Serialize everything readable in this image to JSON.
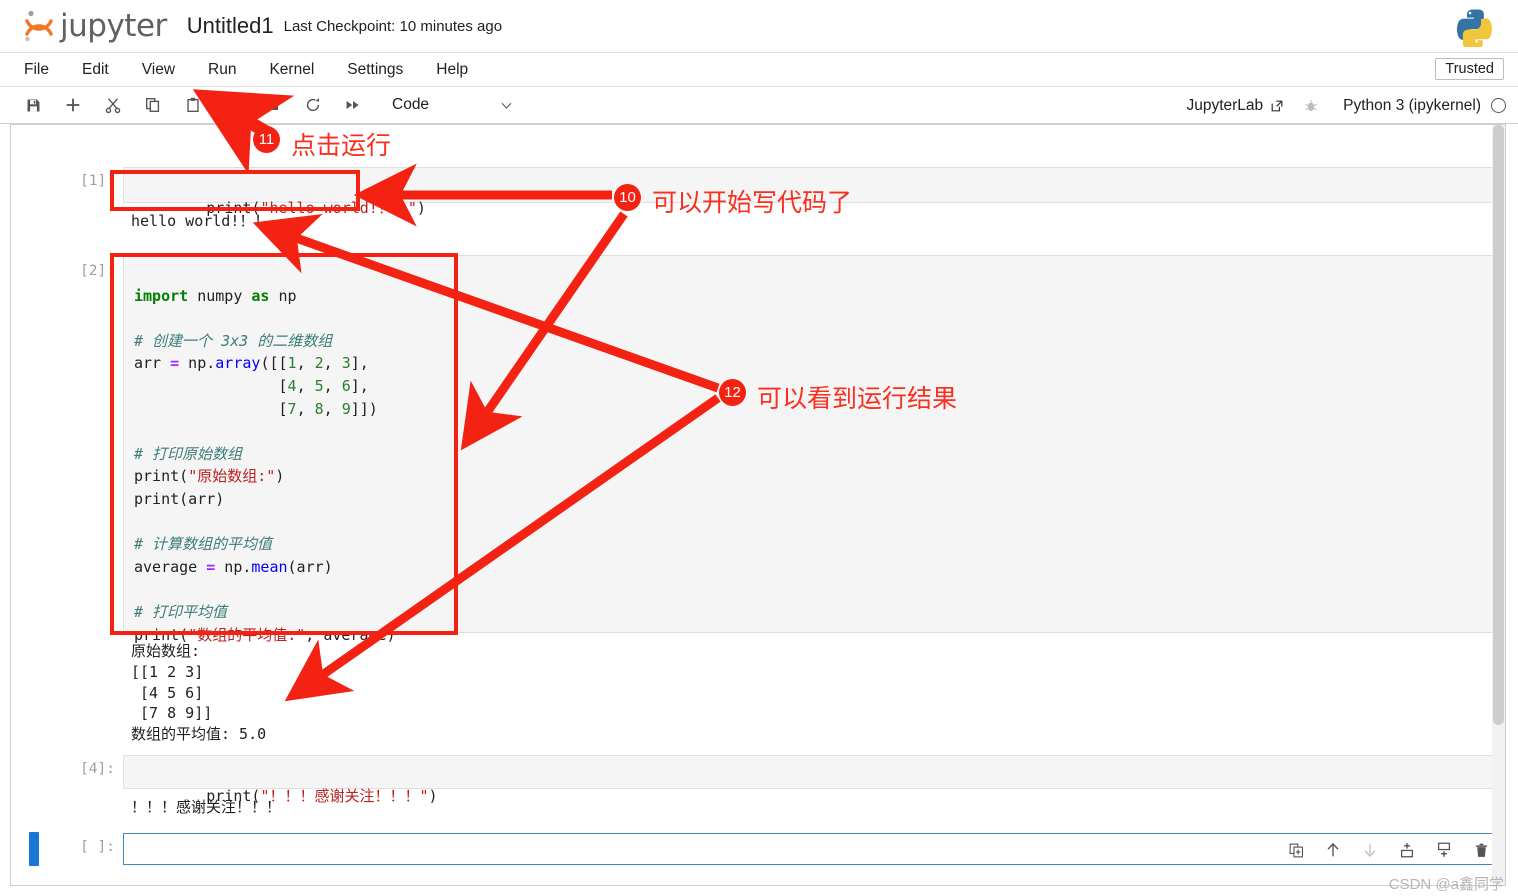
{
  "header": {
    "logo_text": "jupyter",
    "notebook_title": "Untitled1",
    "checkpoint": "Last Checkpoint: 10 minutes ago",
    "python_logo_name": "python-logo"
  },
  "menubar": {
    "items": [
      "File",
      "Edit",
      "View",
      "Run",
      "Kernel",
      "Settings",
      "Help"
    ],
    "trusted": "Trusted"
  },
  "toolbar": {
    "buttons": [
      {
        "name": "save-button",
        "icon": "save-icon"
      },
      {
        "name": "insert-cell-button",
        "icon": "plus-icon"
      },
      {
        "name": "cut-cell-button",
        "icon": "scissors-icon"
      },
      {
        "name": "copy-cell-button",
        "icon": "copy-icon"
      },
      {
        "name": "paste-cell-button",
        "icon": "clipboard-icon"
      },
      {
        "name": "run-cell-button",
        "icon": "play-icon"
      },
      {
        "name": "interrupt-kernel-button",
        "icon": "stop-icon"
      },
      {
        "name": "restart-kernel-button",
        "icon": "restart-icon"
      },
      {
        "name": "restart-run-all-button",
        "icon": "fast-forward-icon"
      }
    ],
    "cell_type": "Code",
    "jupyterlab_label": "JupyterLab",
    "kernel_name": "Python 3 (ipykernel)"
  },
  "cells": [
    {
      "prompt": "[1]:",
      "source_html": "<span class=\"t-pln\">print(</span><span class=\"t-str\">\"hello world!！！\"</span><span class=\"t-pln\">)</span>",
      "source_text": "print(\"hello world!！！\")",
      "output": "hello world!！！"
    },
    {
      "prompt": "[2]:",
      "source_text": "import numpy as np\n\n# 创建一个 3x3 的二维数组\narr = np.array([[1, 2, 3],\n                [4, 5, 6],\n                [7, 8, 9]])\n\n# 打印原始数组\nprint(\"原始数组:\")\nprint(arr)\n\n# 计算数组的平均值\naverage = np.mean(arr)\n\n# 打印平均值\nprint(\"数组的平均值:\", average)",
      "output": "原始数组:\n[[1 2 3]\n [4 5 6]\n [7 8 9]]\n数组的平均值: 5.0"
    },
    {
      "prompt": "[4]:",
      "source_text": "print(\"！！！感谢关注！！！\")",
      "output": "！！！感谢关注！！！"
    },
    {
      "prompt": "[ ]:",
      "source_text": "",
      "output": ""
    }
  ],
  "cell_toolbar": {
    "buttons": [
      {
        "name": "duplicate-cell-icon",
        "label": "duplicate"
      },
      {
        "name": "move-cell-up-icon",
        "label": "move up"
      },
      {
        "name": "move-cell-down-icon",
        "label": "move down"
      },
      {
        "name": "insert-cell-above-icon",
        "label": "insert above"
      },
      {
        "name": "insert-cell-below-icon",
        "label": "insert below"
      },
      {
        "name": "delete-cell-icon",
        "label": "delete"
      }
    ]
  },
  "annotations": [
    {
      "number": "11",
      "text": "点击运行"
    },
    {
      "number": "10",
      "text": "可以开始写代码了"
    },
    {
      "number": "12",
      "text": "可以看到运行结果"
    }
  ],
  "watermark": "CSDN @a鑫同学",
  "colors": {
    "annotation_red": "#f42212",
    "jupyter_orange": "#f37626",
    "selection_blue": "#1976d2",
    "active_cell_border": "#4285c8"
  }
}
